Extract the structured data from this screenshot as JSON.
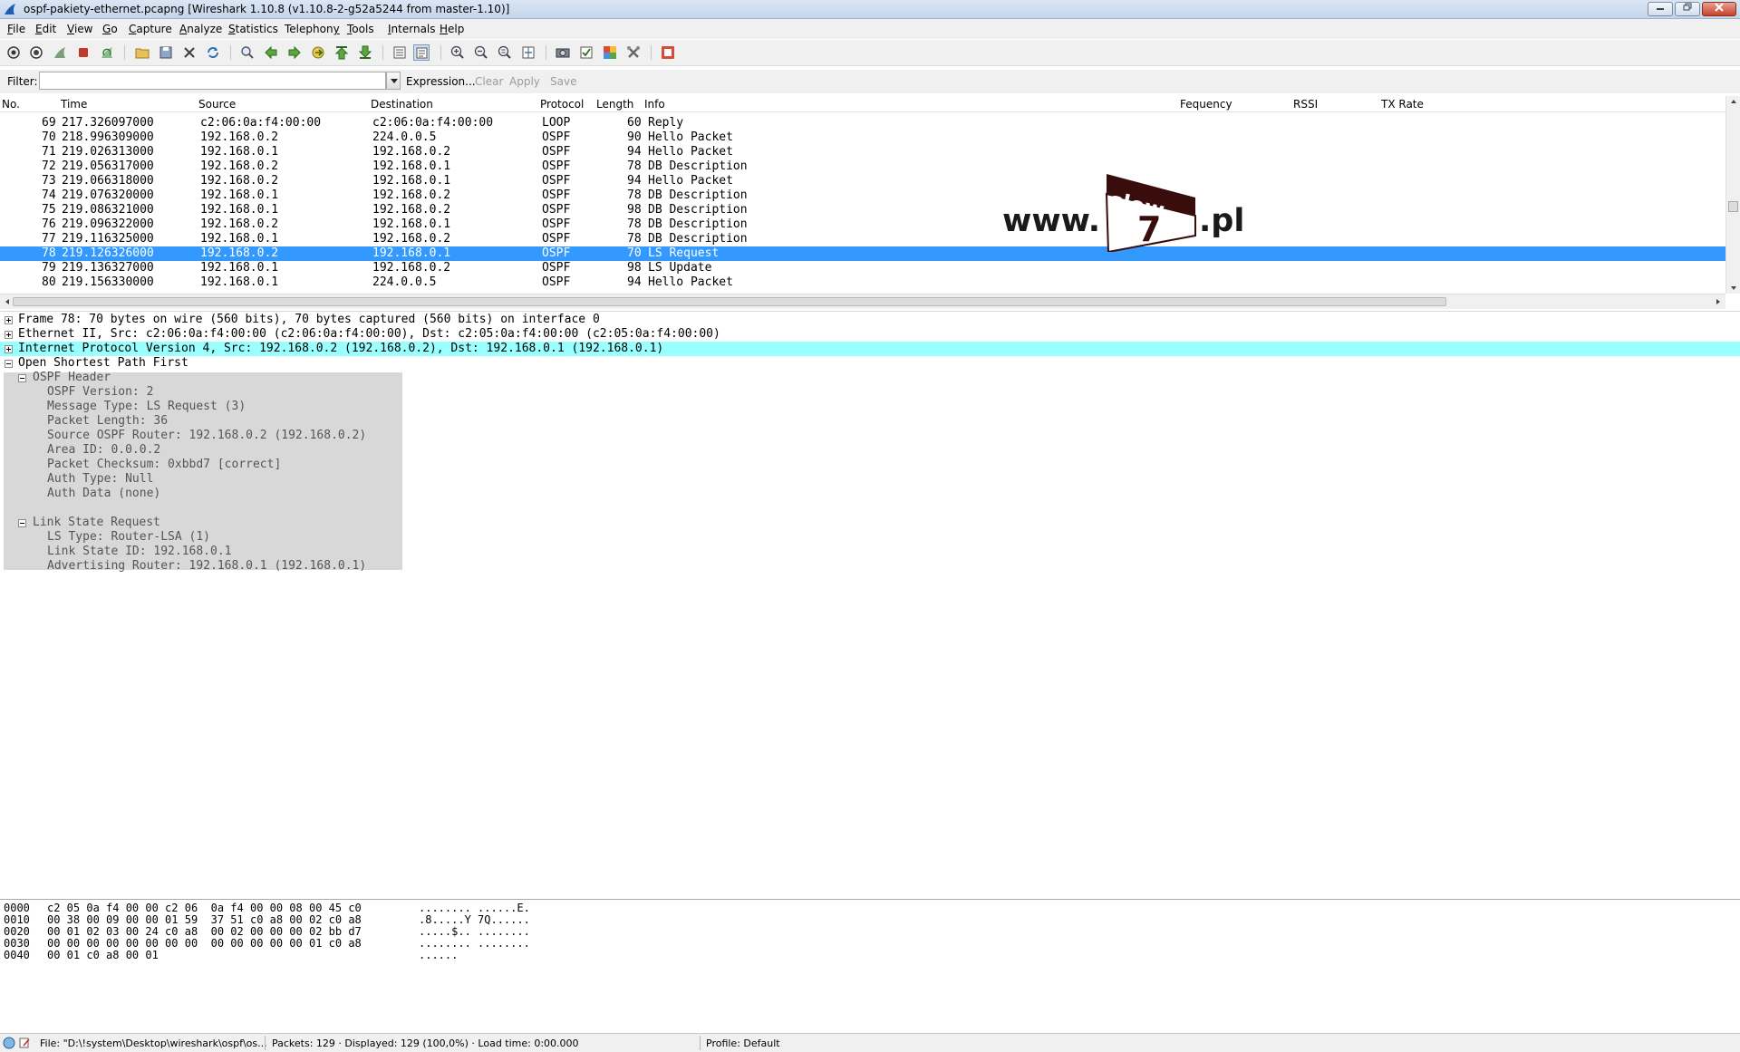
{
  "window": {
    "title": "ospf-pakiety-ethernet.pcapng  [Wireshark 1.10.8  (v1.10.8-2-g52a5244 from master-1.10)]"
  },
  "menu": [
    {
      "pre": "",
      "u": "F",
      "post": "ile"
    },
    {
      "pre": "",
      "u": "E",
      "post": "dit"
    },
    {
      "pre": "",
      "u": "V",
      "post": "iew"
    },
    {
      "pre": "",
      "u": "G",
      "post": "o"
    },
    {
      "pre": "",
      "u": "C",
      "post": "apture"
    },
    {
      "pre": "",
      "u": "A",
      "post": "nalyze"
    },
    {
      "pre": "",
      "u": "S",
      "post": "tatistics"
    },
    {
      "pre": "Telephon",
      "u": "y",
      "post": ""
    },
    {
      "pre": "",
      "u": "T",
      "post": "ools"
    },
    {
      "pre": "",
      "u": "I",
      "post": "nternals"
    },
    {
      "pre": "",
      "u": "H",
      "post": "elp"
    }
  ],
  "filter": {
    "label": "Filter:",
    "value": "",
    "expression": "Expression...",
    "clear": "Clear",
    "apply": "Apply",
    "save": "Save"
  },
  "columns": [
    "No.",
    "Time",
    "Source",
    "Destination",
    "Protocol",
    "Length",
    "Info",
    "Fequency",
    "RSSI",
    "TX Rate"
  ],
  "packets": [
    {
      "no": "69",
      "time": "217.326097000",
      "src": "c2:06:0a:f4:00:00",
      "dst": "c2:06:0a:f4:00:00",
      "proto": "LOOP",
      "len": "60",
      "info": "Reply"
    },
    {
      "no": "70",
      "time": "218.996309000",
      "src": "192.168.0.2",
      "dst": "224.0.0.5",
      "proto": "OSPF",
      "len": "90",
      "info": "Hello Packet"
    },
    {
      "no": "71",
      "time": "219.026313000",
      "src": "192.168.0.1",
      "dst": "192.168.0.2",
      "proto": "OSPF",
      "len": "94",
      "info": "Hello Packet"
    },
    {
      "no": "72",
      "time": "219.056317000",
      "src": "192.168.0.2",
      "dst": "192.168.0.1",
      "proto": "OSPF",
      "len": "78",
      "info": "DB Description"
    },
    {
      "no": "73",
      "time": "219.066318000",
      "src": "192.168.0.2",
      "dst": "192.168.0.1",
      "proto": "OSPF",
      "len": "94",
      "info": "Hello Packet"
    },
    {
      "no": "74",
      "time": "219.076320000",
      "src": "192.168.0.1",
      "dst": "192.168.0.2",
      "proto": "OSPF",
      "len": "78",
      "info": "DB Description"
    },
    {
      "no": "75",
      "time": "219.086321000",
      "src": "192.168.0.1",
      "dst": "192.168.0.2",
      "proto": "OSPF",
      "len": "98",
      "info": "DB Description"
    },
    {
      "no": "76",
      "time": "219.096322000",
      "src": "192.168.0.2",
      "dst": "192.168.0.1",
      "proto": "OSPF",
      "len": "78",
      "info": "DB Description"
    },
    {
      "no": "77",
      "time": "219.116325000",
      "src": "192.168.0.1",
      "dst": "192.168.0.2",
      "proto": "OSPF",
      "len": "78",
      "info": "DB Description"
    },
    {
      "no": "78",
      "time": "219.126326000",
      "src": "192.168.0.2",
      "dst": "192.168.0.1",
      "proto": "OSPF",
      "len": "70",
      "info": "LS Request",
      "selected": true
    },
    {
      "no": "79",
      "time": "219.136327000",
      "src": "192.168.0.1",
      "dst": "192.168.0.2",
      "proto": "OSPF",
      "len": "98",
      "info": "LS Update"
    },
    {
      "no": "80",
      "time": "219.156330000",
      "src": "192.168.0.1",
      "dst": "224.0.0.5",
      "proto": "OSPF",
      "len": "94",
      "info": "Hello Packet"
    }
  ],
  "logo": {
    "prefix": "www.",
    "word": "slow",
    "digit": "7",
    "suffix": ".pl",
    "colors": {
      "banner": "#3a0d0d",
      "text": "#1a1a1a"
    }
  },
  "details": {
    "frame": "Frame 78: 70 bytes on wire (560 bits), 70 bytes captured (560 bits) on interface 0",
    "ethernet": "Ethernet II, Src: c2:06:0a:f4:00:00 (c2:06:0a:f4:00:00), Dst: c2:05:0a:f4:00:00 (c2:05:0a:f4:00:00)",
    "ip": "Internet Protocol Version 4, Src: 192.168.0.2 (192.168.0.2), Dst: 192.168.0.1 (192.168.0.1)",
    "ospf": "Open Shortest Path First",
    "ospf_header": "OSPF Header",
    "header_fields": [
      "OSPF Version: 2",
      "Message Type: LS Request (3)",
      "Packet Length: 36",
      "Source OSPF Router: 192.168.0.2 (192.168.0.2)",
      "Area ID: 0.0.0.2",
      "Packet Checksum: 0xbbd7 [correct]",
      "Auth Type: Null",
      "Auth Data (none)"
    ],
    "lsr": "Link State Request",
    "lsr_fields": [
      "LS Type: Router-LSA (1)",
      "Link State ID: 192.168.0.1",
      "Advertising Router: 192.168.0.1 (192.168.0.1)"
    ],
    "colors": {
      "ip_highlight": "#99ffff",
      "ospf_box": "#d8d8d8",
      "field_text": "#555555"
    }
  },
  "hex": [
    {
      "off": "0000",
      "bytes": "c2 05 0a f4 00 00 c2 06  0a f4 00 00 08 00 45 c0",
      "ascii": "........ ......E."
    },
    {
      "off": "0010",
      "bytes": "00 38 00 09 00 00 01 59  37 51 c0 a8 00 02 c0 a8",
      "ascii": ".8.....Y 7Q......"
    },
    {
      "off": "0020",
      "bytes": "00 01 02 03 00 24 c0 a8  00 02 00 00 00 02 bb d7",
      "ascii": ".....$.. ........"
    },
    {
      "off": "0030",
      "bytes": "00 00 00 00 00 00 00 00  00 00 00 00 00 01 c0 a8",
      "ascii": "........ ........"
    },
    {
      "off": "0040",
      "bytes": "00 01 c0 a8 00 01",
      "ascii": "......"
    }
  ],
  "status": {
    "file": "File: \"D:\\!system\\Desktop\\wireshark\\ospf\\os...",
    "packets": "Packets: 129 · Displayed: 129 (100,0%) · Load time: 0:00.000",
    "profile": "Profile: Default"
  },
  "theme": {
    "selected_row": "#3399ff",
    "chrome": "#f0f0f0"
  }
}
